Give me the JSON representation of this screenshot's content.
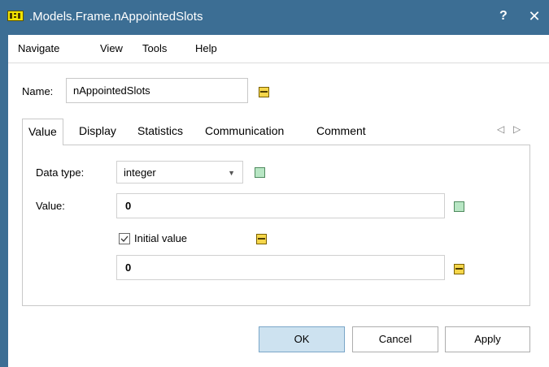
{
  "window": {
    "title": ".Models.Frame.nAppointedSlots",
    "help_label": "?",
    "close_label": "✕"
  },
  "menu": {
    "items": [
      "Navigate",
      "View",
      "Tools",
      "Help"
    ]
  },
  "name_field": {
    "label": "Name:",
    "value": "nAppointedSlots"
  },
  "tabs": {
    "items": [
      "Value",
      "Display",
      "Statistics",
      "Communication",
      "Comment"
    ],
    "active": "Value",
    "prev_arrow": "◁",
    "next_arrow": "▷"
  },
  "value_tab": {
    "data_type_label": "Data type:",
    "data_type_value": "integer",
    "value_label": "Value:",
    "value": "0",
    "initial_value_checkbox_label": "Initial value",
    "initial_value_checked": true,
    "initial_value": "0"
  },
  "buttons": {
    "ok": "OK",
    "cancel": "Cancel",
    "apply": "Apply"
  },
  "colors": {
    "titlebar": "#3c6e94",
    "inherited_indicator": "#f5d64a",
    "local_indicator": "#b8e6c4",
    "default_button": "#cde2f0"
  }
}
